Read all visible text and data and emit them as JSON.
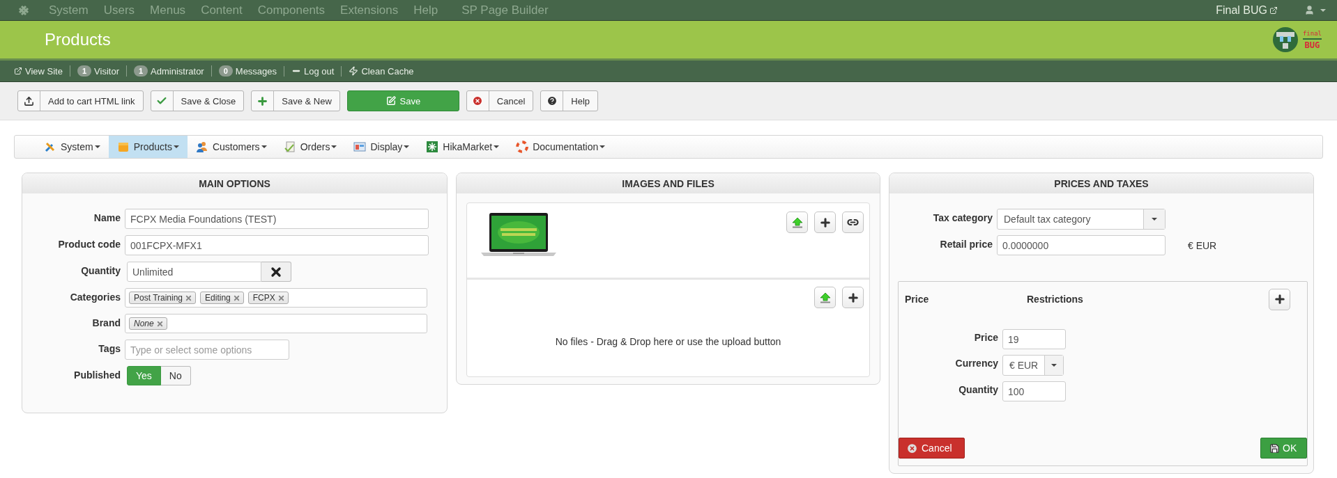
{
  "top_menu": {
    "items": [
      "System",
      "Users",
      "Menus",
      "Content",
      "Components",
      "Extensions",
      "Help",
      "SP Page Builder"
    ],
    "site_link": "Final BUG"
  },
  "header": {
    "title": "Products",
    "logo_text": [
      "final",
      "BUG"
    ]
  },
  "status_bar": [
    {
      "label": "View Site",
      "kind": "link"
    },
    {
      "label": "Visitor",
      "count": "1",
      "kind": "count"
    },
    {
      "label": "Administrator",
      "count": "1",
      "kind": "count"
    },
    {
      "label": "Messages",
      "count": "0",
      "kind": "count"
    },
    {
      "label": "Log out",
      "kind": "logout"
    },
    {
      "label": "Clean Cache",
      "kind": "cache"
    }
  ],
  "toolbar": [
    {
      "label": "Add to cart HTML link",
      "kind": "upload",
      "primary": false
    },
    {
      "label": "Save & Close",
      "kind": "check",
      "primary": false
    },
    {
      "label": "Save & New",
      "kind": "plus",
      "primary": false
    },
    {
      "label": "Save",
      "kind": "edit",
      "primary": true
    },
    {
      "label": "Cancel",
      "kind": "cancel",
      "primary": false
    },
    {
      "label": "Help",
      "kind": "help",
      "primary": false
    }
  ],
  "nav": [
    {
      "label": "System",
      "kind": "tools",
      "selected": false
    },
    {
      "label": "Products",
      "kind": "box",
      "selected": true
    },
    {
      "label": "Customers",
      "kind": "people",
      "selected": false
    },
    {
      "label": "Orders",
      "kind": "orders",
      "selected": false
    },
    {
      "label": "Display",
      "kind": "display",
      "selected": false
    },
    {
      "label": "HikaMarket",
      "kind": "market",
      "selected": false
    },
    {
      "label": "Documentation",
      "kind": "lifebuoy",
      "selected": false
    }
  ],
  "main_options": {
    "title": "MAIN OPTIONS",
    "fields": [
      {
        "label": "Name",
        "kind": "text",
        "value": "FCPX Media Foundations (TEST)"
      },
      {
        "label": "Product code",
        "kind": "text",
        "value": "001FCPX-MFX1"
      },
      {
        "label": "Quantity",
        "kind": "quantity",
        "value": "Unlimited"
      },
      {
        "label": "Categories",
        "kind": "tags",
        "tags": [
          {
            "label": "Post Training",
            "italic": false
          },
          {
            "label": "Editing",
            "italic": false
          },
          {
            "label": "FCPX",
            "italic": false
          }
        ]
      },
      {
        "label": "Brand",
        "kind": "tags",
        "tags": [
          {
            "label": "None",
            "italic": true
          }
        ]
      },
      {
        "label": "Tags",
        "kind": "placeholder",
        "placeholder": "Type or select some options"
      },
      {
        "label": "Published",
        "kind": "toggle",
        "options": [
          {
            "label": "Yes",
            "selected": true
          },
          {
            "label": "No",
            "selected": false
          }
        ]
      }
    ]
  },
  "images_and_files": {
    "title": "IMAGES AND FILES",
    "files_empty_text": "No files - Drag & Drop here or use the upload button"
  },
  "prices_and_taxes": {
    "title": "PRICES AND TAXES",
    "tax_category": {
      "label": "Tax category",
      "value": "Default tax category"
    },
    "retail_price": {
      "label": "Retail price",
      "value": "0.0000000",
      "currency": "€ EUR"
    },
    "price_editor": {
      "columns": [
        "Price",
        "Restrictions"
      ],
      "fields": [
        {
          "label": "Price",
          "kind": "text",
          "value": "19"
        },
        {
          "label": "Currency",
          "kind": "select",
          "value": "€ EUR"
        },
        {
          "label": "Quantity",
          "kind": "text",
          "value": "100"
        }
      ],
      "cancel": "Cancel",
      "ok": "OK"
    }
  }
}
